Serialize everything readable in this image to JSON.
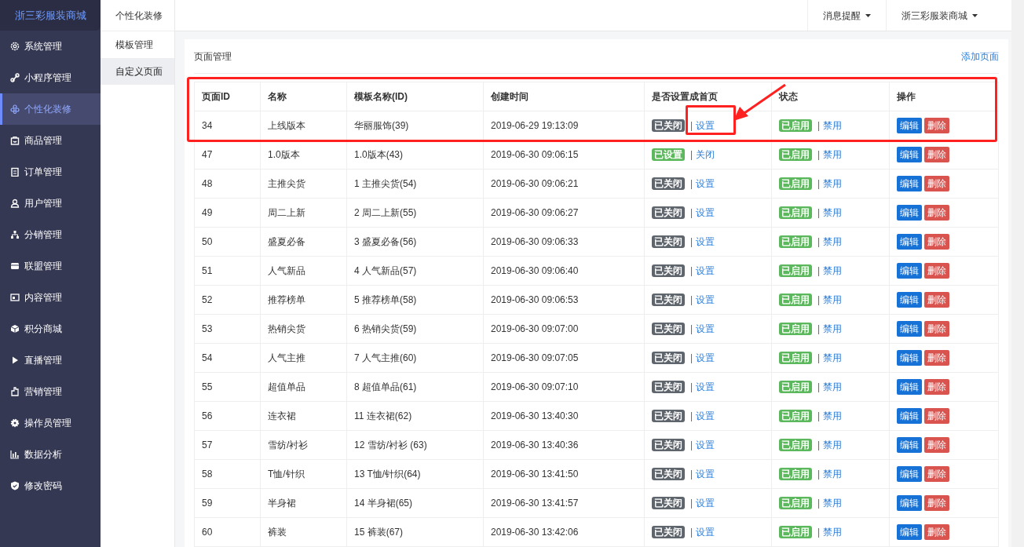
{
  "sidebar": {
    "logo": "浙三彩服装商城",
    "items": [
      {
        "label": "系统管理",
        "selected": false
      },
      {
        "label": "小程序管理",
        "selected": false
      },
      {
        "label": "个性化装修",
        "selected": true
      },
      {
        "label": "商品管理",
        "selected": false
      },
      {
        "label": "订单管理",
        "selected": false
      },
      {
        "label": "用户管理",
        "selected": false
      },
      {
        "label": "分销管理",
        "selected": false
      },
      {
        "label": "联盟管理",
        "selected": false
      },
      {
        "label": "内容管理",
        "selected": false
      },
      {
        "label": "积分商城",
        "selected": false
      },
      {
        "label": "直播管理",
        "selected": false
      },
      {
        "label": "营销管理",
        "selected": false
      },
      {
        "label": "操作员管理",
        "selected": false
      },
      {
        "label": "数据分析",
        "selected": false
      },
      {
        "label": "修改密码",
        "selected": false
      }
    ]
  },
  "subnav": {
    "title": "个性化装修",
    "items": [
      {
        "label": "模板管理",
        "selected": false
      },
      {
        "label": "自定义页面",
        "selected": true
      }
    ]
  },
  "topbar": {
    "menus": [
      "消息提醒",
      "浙三彩服装商城"
    ]
  },
  "card": {
    "title": "页面管理",
    "action": "添加页面"
  },
  "table": {
    "columns": [
      "页面ID",
      "名称",
      "模板名称(ID)",
      "创建时间",
      "是否设置成首页",
      "状态",
      "操作"
    ],
    "rows": [
      {
        "id": "34",
        "name": "上线版本",
        "template": "华丽服饰(39)",
        "created": "2019-06-29 19:13:09",
        "home": false,
        "home_badge": "已关闭",
        "home_separator": "|",
        "home_link": "设置",
        "enabled": true,
        "status_badge": "已启用",
        "status_separator": "|",
        "status_link": "禁用",
        "edit": "编辑",
        "delete": "删除",
        "highlighted": true
      },
      {
        "id": "47",
        "name": "1.0版本",
        "template": "1.0版本(43)",
        "created": "2019-06-30 09:06:15",
        "home": true,
        "home_badge": "已设置",
        "home_separator": "|",
        "home_link": "关闭",
        "enabled": true,
        "status_badge": "已启用",
        "status_separator": "|",
        "status_link": "禁用",
        "edit": "编辑",
        "delete": "删除",
        "highlighted": false
      },
      {
        "id": "48",
        "name": "主推尖货",
        "template": "1 主推尖货(54)",
        "created": "2019-06-30 09:06:21",
        "home": false,
        "home_badge": "已关闭",
        "home_separator": "|",
        "home_link": "设置",
        "enabled": true,
        "status_badge": "已启用",
        "status_separator": "|",
        "status_link": "禁用",
        "edit": "编辑",
        "delete": "删除",
        "highlighted": false
      },
      {
        "id": "49",
        "name": "周二上新",
        "template": "2 周二上新(55)",
        "created": "2019-06-30 09:06:27",
        "home": false,
        "home_badge": "已关闭",
        "home_separator": "|",
        "home_link": "设置",
        "enabled": true,
        "status_badge": "已启用",
        "status_separator": "|",
        "status_link": "禁用",
        "edit": "编辑",
        "delete": "删除",
        "highlighted": false
      },
      {
        "id": "50",
        "name": "盛夏必备",
        "template": "3 盛夏必备(56)",
        "created": "2019-06-30 09:06:33",
        "home": false,
        "home_badge": "已关闭",
        "home_separator": "|",
        "home_link": "设置",
        "enabled": true,
        "status_badge": "已启用",
        "status_separator": "|",
        "status_link": "禁用",
        "edit": "编辑",
        "delete": "删除",
        "highlighted": false
      },
      {
        "id": "51",
        "name": "人气新品",
        "template": "4 人气新品(57)",
        "created": "2019-06-30 09:06:40",
        "home": false,
        "home_badge": "已关闭",
        "home_separator": "|",
        "home_link": "设置",
        "enabled": true,
        "status_badge": "已启用",
        "status_separator": "|",
        "status_link": "禁用",
        "edit": "编辑",
        "delete": "删除",
        "highlighted": false
      },
      {
        "id": "52",
        "name": "推荐榜单",
        "template": "5 推荐榜单(58)",
        "created": "2019-06-30 09:06:53",
        "home": false,
        "home_badge": "已关闭",
        "home_separator": "|",
        "home_link": "设置",
        "enabled": true,
        "status_badge": "已启用",
        "status_separator": "|",
        "status_link": "禁用",
        "edit": "编辑",
        "delete": "删除",
        "highlighted": false
      },
      {
        "id": "53",
        "name": "热销尖货",
        "template": "6 热销尖货(59)",
        "created": "2019-06-30 09:07:00",
        "home": false,
        "home_badge": "已关闭",
        "home_separator": "|",
        "home_link": "设置",
        "enabled": true,
        "status_badge": "已启用",
        "status_separator": "|",
        "status_link": "禁用",
        "edit": "编辑",
        "delete": "删除",
        "highlighted": false
      },
      {
        "id": "54",
        "name": "人气主推",
        "template": "7 人气主推(60)",
        "created": "2019-06-30 09:07:05",
        "home": false,
        "home_badge": "已关闭",
        "home_separator": "|",
        "home_link": "设置",
        "enabled": true,
        "status_badge": "已启用",
        "status_separator": "|",
        "status_link": "禁用",
        "edit": "编辑",
        "delete": "删除",
        "highlighted": false
      },
      {
        "id": "55",
        "name": "超值单品",
        "template": "8 超值单品(61)",
        "created": "2019-06-30 09:07:10",
        "home": false,
        "home_badge": "已关闭",
        "home_separator": "|",
        "home_link": "设置",
        "enabled": true,
        "status_badge": "已启用",
        "status_separator": "|",
        "status_link": "禁用",
        "edit": "编辑",
        "delete": "删除",
        "highlighted": false
      },
      {
        "id": "56",
        "name": "连衣裙",
        "template": "11 连衣裙(62)",
        "created": "2019-06-30 13:40:30",
        "home": false,
        "home_badge": "已关闭",
        "home_separator": "|",
        "home_link": "设置",
        "enabled": true,
        "status_badge": "已启用",
        "status_separator": "|",
        "status_link": "禁用",
        "edit": "编辑",
        "delete": "删除",
        "highlighted": false
      },
      {
        "id": "57",
        "name": "雪纺/衬衫",
        "template": "12 雪纺/衬衫 (63)",
        "created": "2019-06-30 13:40:36",
        "home": false,
        "home_badge": "已关闭",
        "home_separator": "|",
        "home_link": "设置",
        "enabled": true,
        "status_badge": "已启用",
        "status_separator": "|",
        "status_link": "禁用",
        "edit": "编辑",
        "delete": "删除",
        "highlighted": false
      },
      {
        "id": "58",
        "name": "T恤/针织",
        "template": "13 T恤/针织(64)",
        "created": "2019-06-30 13:41:50",
        "home": false,
        "home_badge": "已关闭",
        "home_separator": "|",
        "home_link": "设置",
        "enabled": true,
        "status_badge": "已启用",
        "status_separator": "|",
        "status_link": "禁用",
        "edit": "编辑",
        "delete": "删除",
        "highlighted": false
      },
      {
        "id": "59",
        "name": "半身裙",
        "template": "14 半身裙(65)",
        "created": "2019-06-30 13:41:57",
        "home": false,
        "home_badge": "已关闭",
        "home_separator": "|",
        "home_link": "设置",
        "enabled": true,
        "status_badge": "已启用",
        "status_separator": "|",
        "status_link": "禁用",
        "edit": "编辑",
        "delete": "删除",
        "highlighted": false
      },
      {
        "id": "60",
        "name": "裤装",
        "template": "15 裤装(67)",
        "created": "2019-06-30 13:42:06",
        "home": false,
        "home_badge": "已关闭",
        "home_separator": "|",
        "home_link": "设置",
        "enabled": true,
        "status_badge": "已启用",
        "status_separator": "|",
        "status_link": "禁用",
        "edit": "编辑",
        "delete": "删除",
        "highlighted": false
      }
    ]
  }
}
